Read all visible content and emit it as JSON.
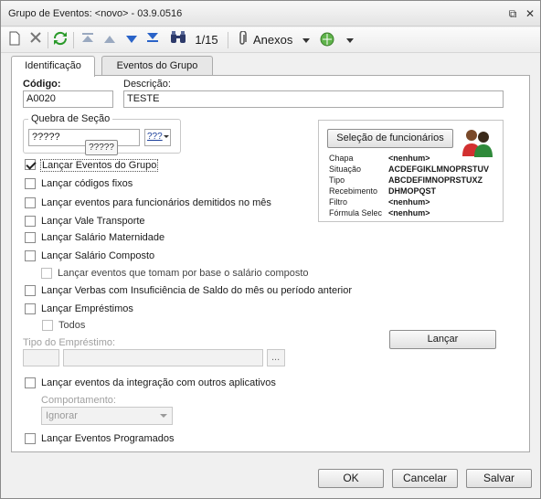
{
  "window": {
    "title": "Grupo de Eventos: <novo> - 03.9.0516",
    "restore_glyph": "⧉",
    "close_glyph": "✕"
  },
  "toolbar": {
    "record_counter": "1/15",
    "anexos_label": "Anexos"
  },
  "tabs": [
    {
      "label": "Identificação"
    },
    {
      "label": "Eventos do Grupo"
    }
  ],
  "form": {
    "codigo_label": "Código:",
    "codigo_value": "A0020",
    "descricao_label": "Descrição:",
    "descricao_value": "TESTE",
    "quebra_label": "Quebra de Seção",
    "quebra_value": "?????",
    "quebra_picker": "???",
    "quebra_tooltip": "?????",
    "selecao_button": "Seleção de funcionários",
    "info": [
      {
        "key": "Chapa",
        "value": "<nenhum>"
      },
      {
        "key": "Situação",
        "value": "ACDEFGIKLMNOPRSTUV"
      },
      {
        "key": "Tipo",
        "value": "ABCDEFIMNOPRSTUXZ"
      },
      {
        "key": "Recebimento",
        "value": "DHMOPQST"
      },
      {
        "key": "Filtro",
        "value": "<nenhum>"
      },
      {
        "key": "Fórmula Selec",
        "value": "<nenhum>"
      }
    ],
    "checkboxes": [
      {
        "label": "Lançar Eventos do Grupo",
        "checked": true
      },
      {
        "label": "Lançar códigos fixos",
        "checked": false
      },
      {
        "label": "Lançar eventos para funcionários demitidos no mês",
        "checked": false
      },
      {
        "label": "Lançar Vale Transporte",
        "checked": false
      },
      {
        "label": "Lançar Salário Maternidade",
        "checked": false
      },
      {
        "label": "Lançar Salário Composto",
        "checked": false
      },
      {
        "label": "Lançar eventos que tomam por base o salário composto",
        "checked": false
      },
      {
        "label": "Lançar Verbas com Insuficiência de Saldo do mês ou período anterior",
        "checked": false
      },
      {
        "label": "Lançar Empréstimos",
        "checked": false
      },
      {
        "label": "Todos",
        "checked": false
      },
      {
        "label": "Lançar eventos da integração com outros aplicativos",
        "checked": false
      },
      {
        "label": "Lançar Eventos Programados",
        "checked": false
      }
    ],
    "tipo_emprestimo_label": "Tipo do Empréstimo:",
    "ellipsis": "...",
    "lancar_button": "Lançar",
    "comportamento_label": "Comportamento:",
    "comportamento_value": "Ignorar"
  },
  "footer": {
    "ok": "OK",
    "cancelar": "Cancelar",
    "salvar": "Salvar"
  }
}
